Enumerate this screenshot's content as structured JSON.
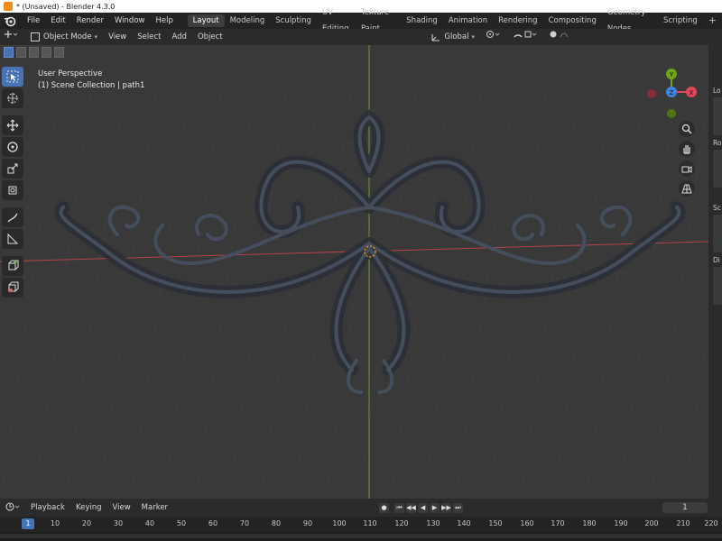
{
  "window": {
    "title": "* (Unsaved) - Blender 4.3.0"
  },
  "menu": {
    "items": [
      "File",
      "Edit",
      "Render",
      "Window",
      "Help"
    ]
  },
  "workspaces": {
    "tabs": [
      "Layout",
      "Modeling",
      "Sculpting",
      "UV Editing",
      "Texture Paint",
      "Shading",
      "Animation",
      "Rendering",
      "Compositing",
      "Geometry Nodes",
      "Scripting"
    ],
    "active": "Layout",
    "add_label": "+"
  },
  "header": {
    "mode": "Object Mode",
    "menus": [
      "View",
      "Select",
      "Add",
      "Object"
    ],
    "transform_orientation": "Global"
  },
  "viewport": {
    "perspective_label": "User Perspective",
    "collection_label": "(1) Scene Collection | path1"
  },
  "gizmo": {
    "x_label": "X",
    "y_label": "Y",
    "z_label": "Z",
    "colors": {
      "x": "#e0475a",
      "y": "#6fa318",
      "z": "#3d84e5"
    }
  },
  "sidebar": {
    "labels": [
      "Lo",
      "Ro",
      "Sc",
      "Di"
    ]
  },
  "timeline": {
    "menus": [
      "Playback",
      "Keying",
      "View",
      "Marker"
    ],
    "current_frame": "1",
    "ruler_current": "1",
    "ruler_ticks": [
      "10",
      "20",
      "30",
      "40",
      "50",
      "60",
      "70",
      "80",
      "90",
      "100",
      "110",
      "120",
      "130",
      "140",
      "150",
      "160",
      "170",
      "180",
      "190",
      "200",
      "210",
      "220"
    ]
  },
  "colors": {
    "accent": "#4772b3",
    "viewport_bg": "#393939",
    "x_axis": "#b9424b",
    "y_axis": "#6a9f2a"
  }
}
